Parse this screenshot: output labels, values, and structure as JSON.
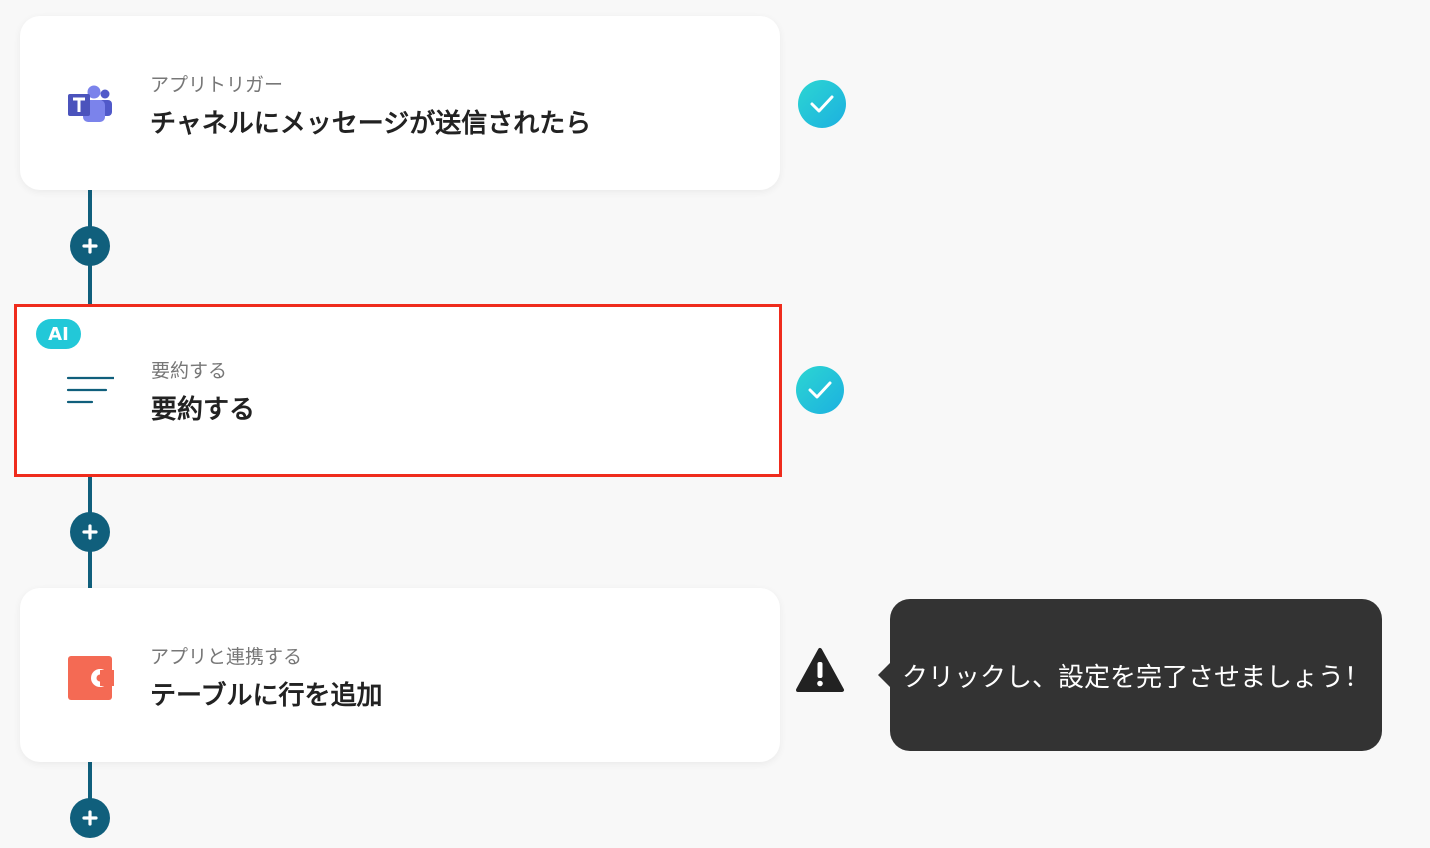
{
  "steps": [
    {
      "icon": "microsoft-teams-icon",
      "subtitle": "アプリトリガー",
      "title": "チャネルにメッセージが送信されたら",
      "status": "complete"
    },
    {
      "badge": "AI",
      "icon": "summarize-lines-icon",
      "subtitle": "要約する",
      "title": "要約する",
      "status": "complete",
      "selected": true
    },
    {
      "icon": "coda-app-icon",
      "subtitle": "アプリと連携する",
      "title": "テーブルに行を追加",
      "status": "warning"
    }
  ],
  "tooltip": {
    "text": "クリックし、設定を完了させましょう！"
  },
  "colors": {
    "connector": "#105f7c",
    "check": "#22c8d8",
    "selected_border": "#ef2c1d",
    "tooltip_bg": "#333333",
    "coda": "#f46a54",
    "teams": "#5059c9"
  }
}
